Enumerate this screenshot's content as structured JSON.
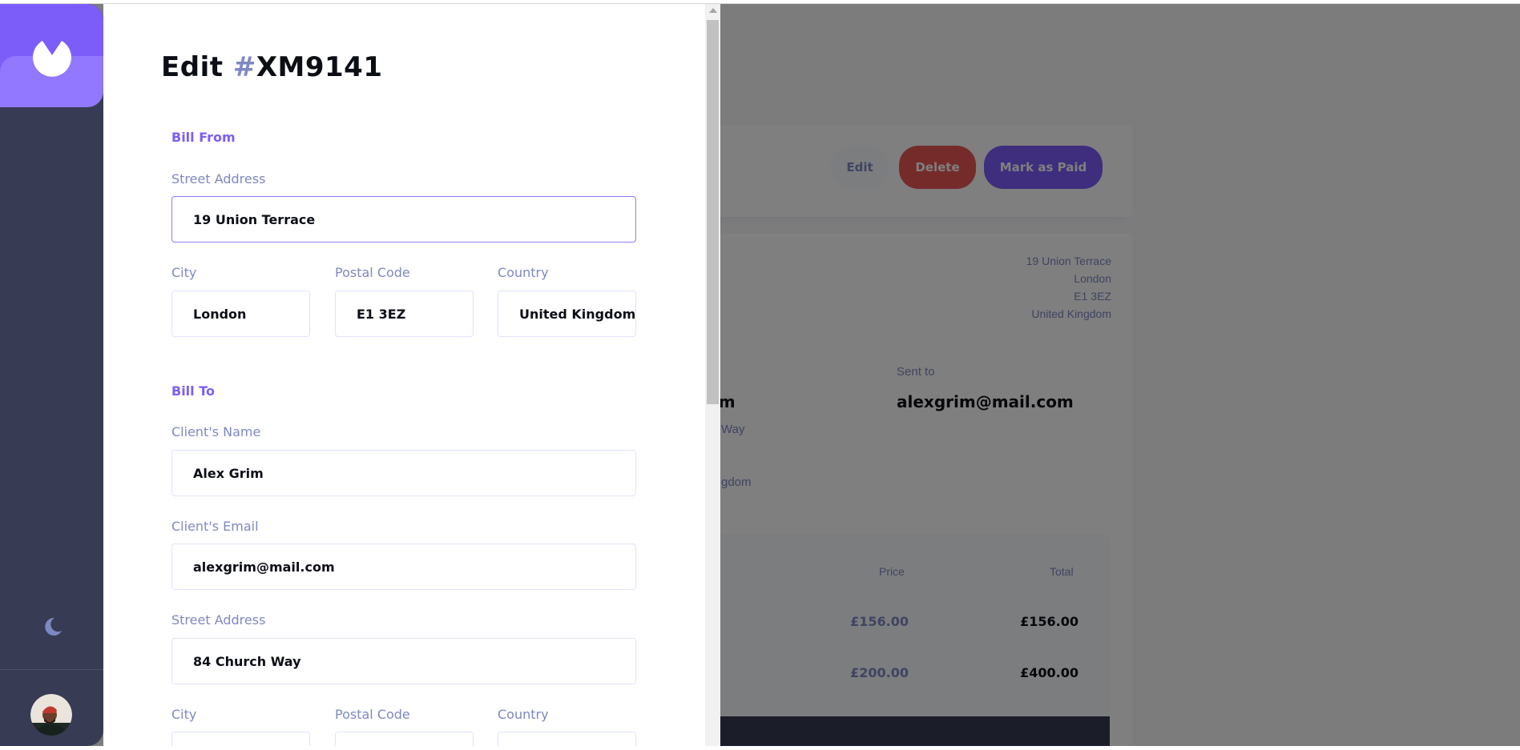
{
  "invoice_bg": {
    "actions": {
      "edit": "Edit",
      "delete": "Delete",
      "mark_paid": "Mark as Paid"
    },
    "sender_address": [
      "19 Union Terrace",
      "London",
      "E1 3EZ",
      "United Kingdom"
    ],
    "client_name_partial": "rim",
    "client_street_partial": "Way",
    "client_country_partial": "gdom",
    "sent_to_label": "Sent to",
    "sent_to_email": "alexgrim@mail.com",
    "table_headers": {
      "price": "Price",
      "total": "Total"
    },
    "items": [
      {
        "price": "£156.00",
        "total": "£156.00"
      },
      {
        "price": "£200.00",
        "total": "£400.00"
      }
    ]
  },
  "form": {
    "title_prefix": "Edit ",
    "title_hash": "#",
    "title_id": "XM9141",
    "bill_from": {
      "heading": "Bill From",
      "street_label": "Street Address",
      "street_value": "19 Union Terrace",
      "city_label": "City",
      "city_value": "London",
      "postal_label": "Postal Code",
      "postal_value": "E1 3EZ",
      "country_label": "Country",
      "country_value": "United Kingdom"
    },
    "bill_to": {
      "heading": "Bill To",
      "name_label": "Client's Name",
      "name_value": "Alex Grim",
      "email_label": "Client's Email",
      "email_value": "alexgrim@mail.com",
      "street_label": "Street Address",
      "street_value": "84 Church Way",
      "city_label": "City",
      "postal_label": "Postal Code",
      "country_label": "Country"
    }
  },
  "sidebar": {
    "icons": {
      "logo": "app-logo-icon",
      "theme": "moon-icon",
      "avatar": "user-avatar"
    }
  },
  "colors": {
    "accent": "#7c5dfa",
    "accent_light": "#9277ff",
    "danger": "#ec5757",
    "sidebar": "#373b53",
    "muted_text": "#7e88c3"
  }
}
